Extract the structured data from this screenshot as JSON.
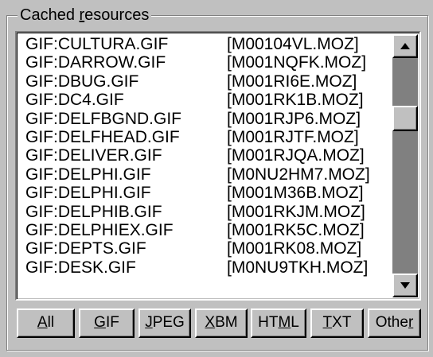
{
  "group": {
    "title_prefix": "Cached ",
    "title_accel": "r",
    "title_rest": "esources"
  },
  "rows": [
    {
      "name": "GIF:CULTURA.GIF",
      "id": "[M00104VL.MOZ]"
    },
    {
      "name": "GIF:DARROW.GIF",
      "id": "[M001NQFK.MOZ]"
    },
    {
      "name": "GIF:DBUG.GIF",
      "id": "[M001RI6E.MOZ]"
    },
    {
      "name": "GIF:DC4.GIF",
      "id": "[M001RK1B.MOZ]"
    },
    {
      "name": "GIF:DELFBGND.GIF",
      "id": "[M001RJP6.MOZ]"
    },
    {
      "name": "GIF:DELFHEAD.GIF",
      "id": "[M001RJTF.MOZ]"
    },
    {
      "name": "GIF:DELIVER.GIF",
      "id": "[M001RJQA.MOZ]"
    },
    {
      "name": "GIF:DELPHI.GIF",
      "id": "[M0NU2HM7.MOZ]"
    },
    {
      "name": "GIF:DELPHI.GIF",
      "id": "[M001M36B.MOZ]"
    },
    {
      "name": "GIF:DELPHIB.GIF",
      "id": "[M001RKJM.MOZ]"
    },
    {
      "name": "GIF:DELPHIEX.GIF",
      "id": "[M001RK5C.MOZ]"
    },
    {
      "name": "GIF:DEPTS.GIF",
      "id": "[M001RK08.MOZ]"
    },
    {
      "name": "GIF:DESK.GIF",
      "id": "[M0NU9TKH.MOZ]"
    }
  ],
  "buttons": {
    "all": {
      "pre": "",
      "accel": "A",
      "post": "ll"
    },
    "gif": {
      "pre": "",
      "accel": "G",
      "post": "IF"
    },
    "jpeg": {
      "pre": "",
      "accel": "J",
      "post": "PEG"
    },
    "xbm": {
      "pre": "",
      "accel": "X",
      "post": "BM"
    },
    "html": {
      "pre": "HT",
      "accel": "M",
      "post": "L"
    },
    "txt": {
      "pre": "",
      "accel": "T",
      "post": "XT"
    },
    "other": {
      "pre": "Othe",
      "accel": "r",
      "post": ""
    }
  },
  "scrollbar": {
    "position_fraction": 0.5
  },
  "icons": {
    "scroll_up": "arrow-up-icon",
    "scroll_down": "arrow-down-icon"
  }
}
